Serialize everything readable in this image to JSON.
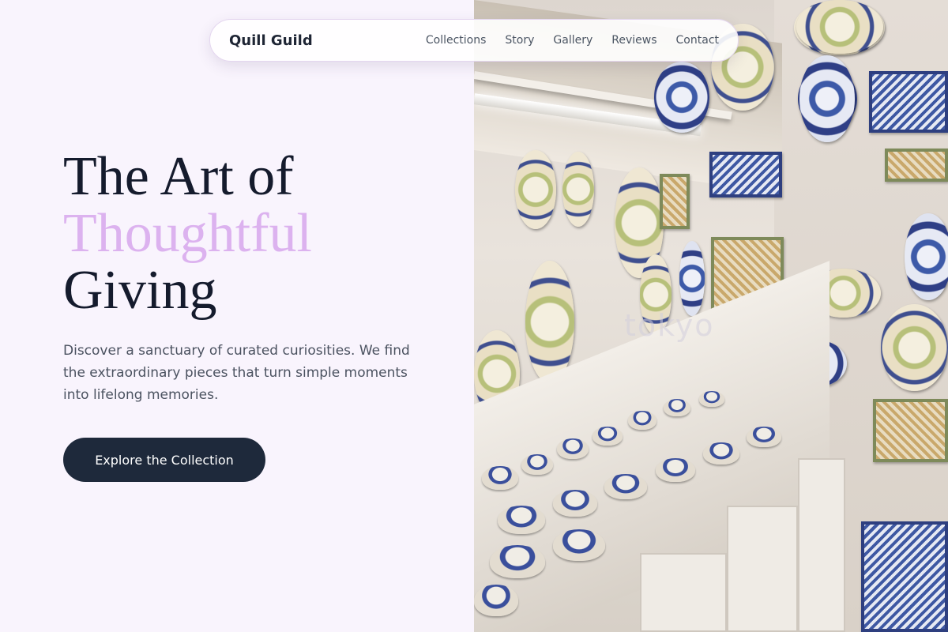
{
  "nav": {
    "brand": "Quill Guild",
    "links": [
      "Collections",
      "Story",
      "Gallery",
      "Reviews",
      "Contact"
    ]
  },
  "hero": {
    "headline_line1": "The Art of",
    "headline_accent": "Thoughtful",
    "headline_line3": "Giving",
    "description": "Discover a sanctuary of curated curiosities. We find the extraordinary pieces that turn simple moments into lifelong memories.",
    "cta_label": "Explore the Collection"
  },
  "image": {
    "watermark_text": "tokyo"
  },
  "colors": {
    "background": "#f9f4fd",
    "heading": "#151b2d",
    "accent": "#dcb2ef",
    "button": "#1e293b"
  }
}
